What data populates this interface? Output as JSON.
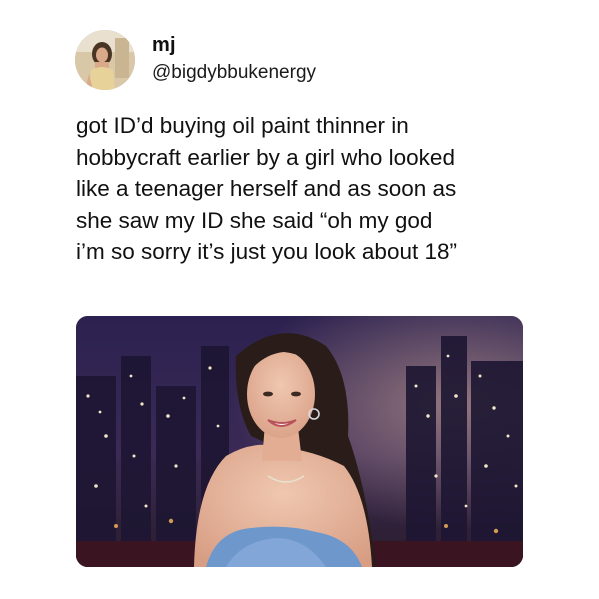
{
  "tweet": {
    "author": {
      "name": "mj",
      "handle": "@bigdybbukenergy",
      "avatar_icon": "profile-photo"
    },
    "text": "got ID’d buying oil paint thinner in\nhobbycraft earlier by a girl who looked\nlike a teenager herself and as soon as\nshe saw my ID she said “oh my god\ni’m so sorry it’s just you look about 18”",
    "media": {
      "kind": "photo"
    }
  },
  "colors": {
    "background": "#ffffff",
    "text": "#111111",
    "media_backdrop": "#241a3a",
    "dress": "#6e97cc"
  }
}
